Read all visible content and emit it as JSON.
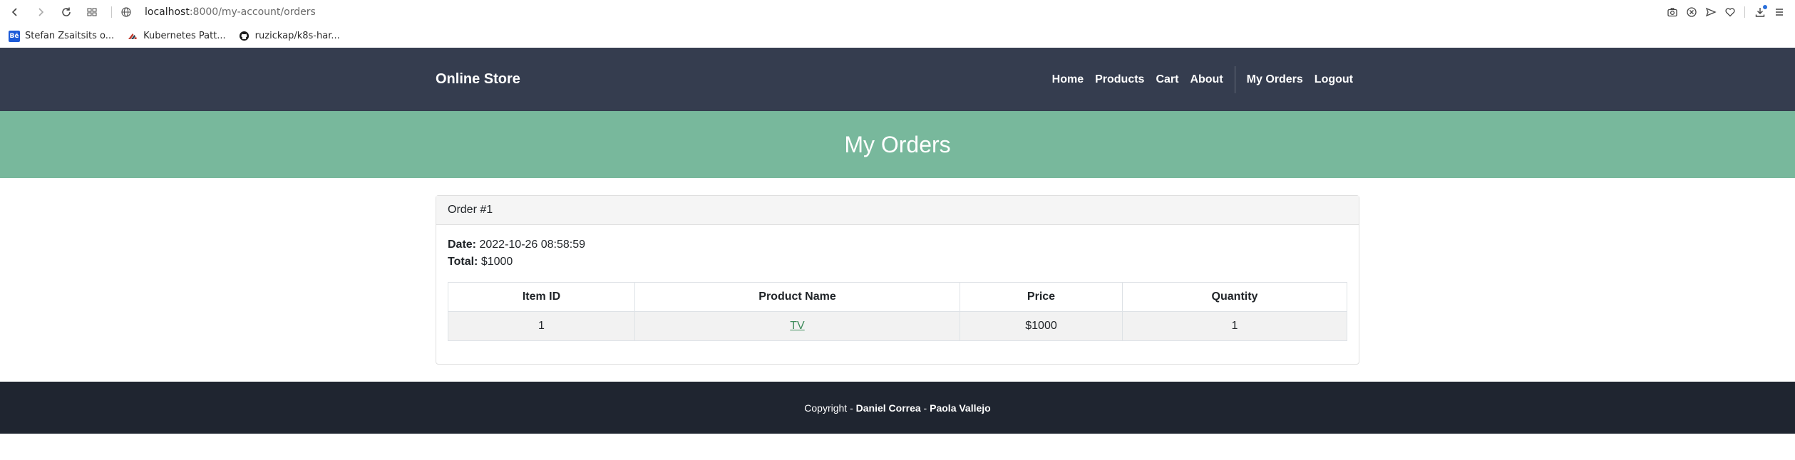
{
  "browser": {
    "url_host": "localhost",
    "url_path": ":8000/my-account/orders",
    "bookmarks": [
      {
        "label": "Stefan Zsaitsits o...",
        "icon": "behance-icon"
      },
      {
        "label": "Kubernetes Patt...",
        "icon": "kubernetes-patterns-icon"
      },
      {
        "label": "ruzickap/k8s-har...",
        "icon": "github-icon"
      }
    ]
  },
  "nav": {
    "brand": "Online Store",
    "links": [
      "Home",
      "Products",
      "Cart",
      "About"
    ],
    "account_links": [
      "My Orders",
      "Logout"
    ]
  },
  "header": {
    "title": "My Orders"
  },
  "order": {
    "heading": "Order #1",
    "date_label": "Date:",
    "date_value": "2022-10-26 08:58:59",
    "total_label": "Total:",
    "total_value": "$1000",
    "columns": [
      "Item ID",
      "Product Name",
      "Price",
      "Quantity"
    ],
    "rows": [
      {
        "item_id": "1",
        "product_name": "TV",
        "price": "$1000",
        "quantity": "1"
      }
    ]
  },
  "footer": {
    "prefix": "Copyright - ",
    "author1": "Daniel Correa",
    "separator": " - ",
    "author2": "Paola Vallejo"
  },
  "colors": {
    "navbar": "#353d4f",
    "masthead": "#78b89c",
    "footer": "#1f2530",
    "link": "#3d8b5a"
  }
}
